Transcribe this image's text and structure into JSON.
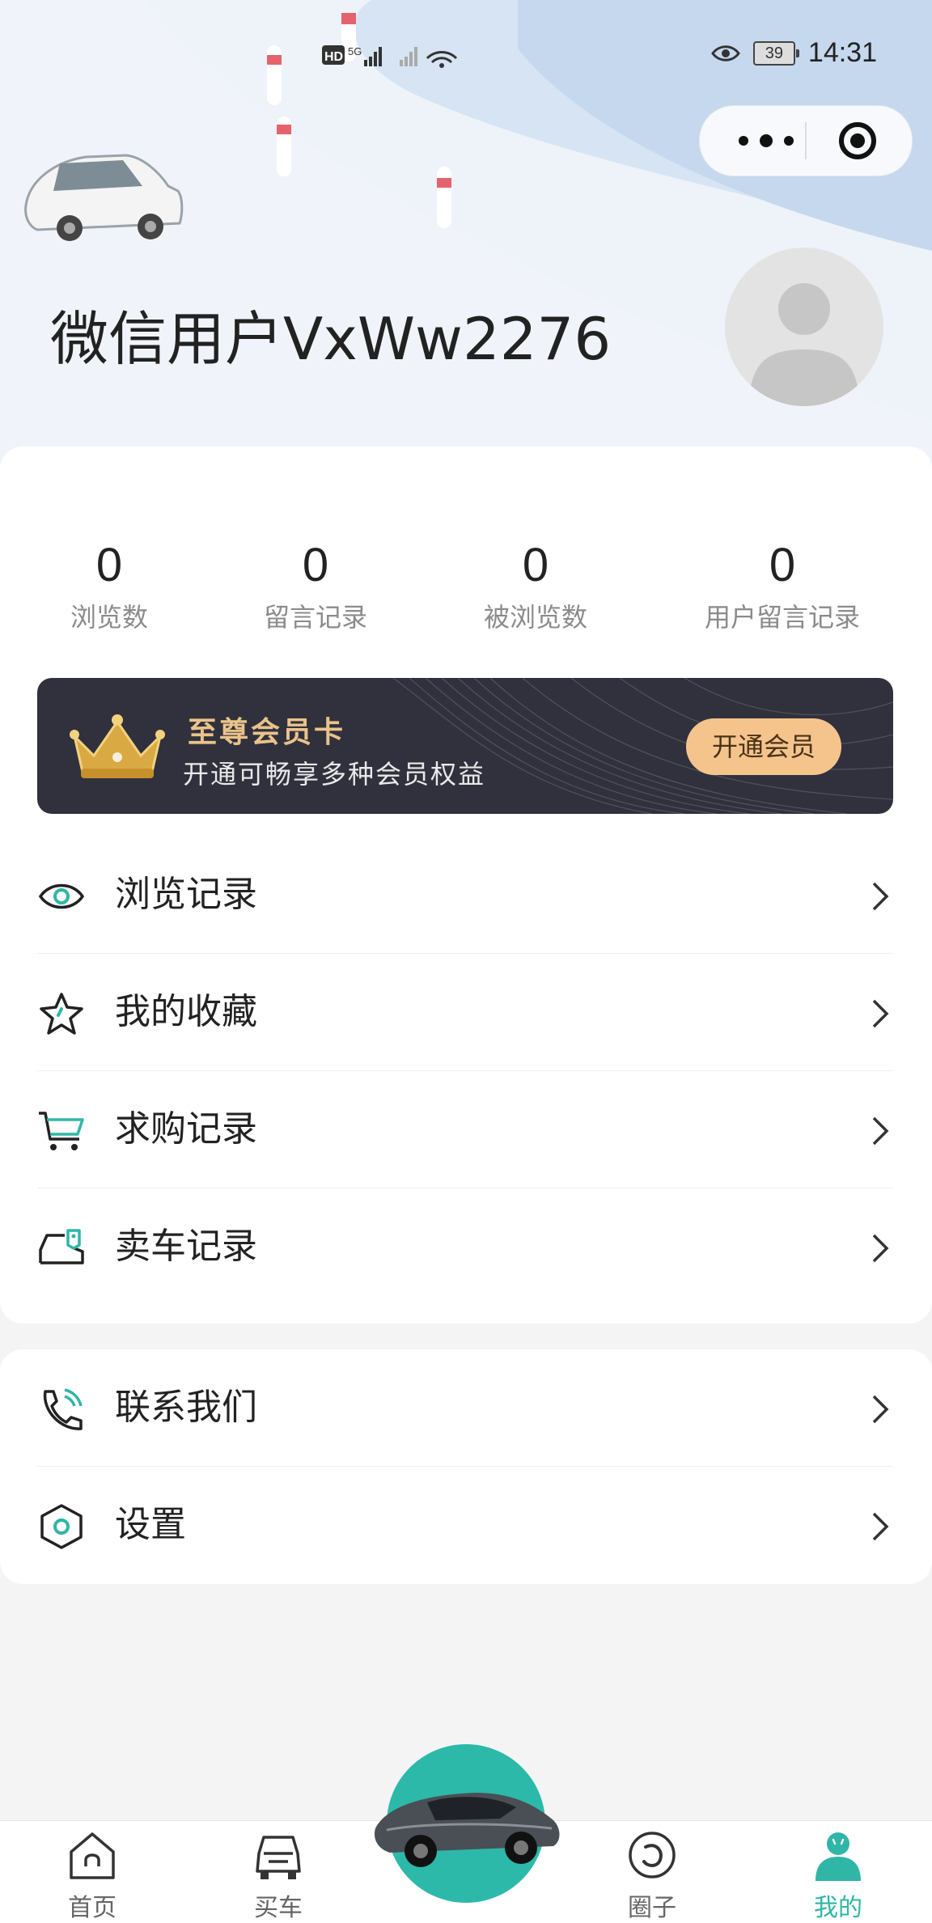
{
  "status_bar": {
    "network": "HD 5G",
    "battery": "39",
    "time": "14:31"
  },
  "capsule": {
    "more_icon": "more-dots-icon",
    "close_icon": "target-icon"
  },
  "profile": {
    "username": "微信用户VxWw2276"
  },
  "stats": [
    {
      "value": "0",
      "label": "浏览数"
    },
    {
      "value": "0",
      "label": "留言记录"
    },
    {
      "value": "0",
      "label": "被浏览数"
    },
    {
      "value": "0",
      "label": "用户留言记录"
    }
  ],
  "vip": {
    "title": "至尊会员卡",
    "subtitle": "开通可畅享多种会员权益",
    "button": "开通会员"
  },
  "menu1": [
    {
      "label": "浏览记录",
      "icon": "eye-icon"
    },
    {
      "label": "我的收藏",
      "icon": "star-icon"
    },
    {
      "label": "求购记录",
      "icon": "cart-icon"
    },
    {
      "label": "卖车记录",
      "icon": "car-tag-icon"
    }
  ],
  "menu2": [
    {
      "label": "联系我们",
      "icon": "phone-icon"
    },
    {
      "label": "设置",
      "icon": "settings-icon"
    }
  ],
  "tabbar": [
    {
      "label": "首页",
      "icon": "home-icon",
      "active": false
    },
    {
      "label": "买车",
      "icon": "car-front-icon",
      "active": false
    },
    {
      "label": "圈子",
      "icon": "circle-icon",
      "active": false
    },
    {
      "label": "我的",
      "icon": "user-icon",
      "active": true
    }
  ],
  "colors": {
    "accent": "#2fb6a6",
    "vip_bg": "#30313c",
    "vip_gold": "#eac38b",
    "vip_button": "#f5c48d"
  }
}
